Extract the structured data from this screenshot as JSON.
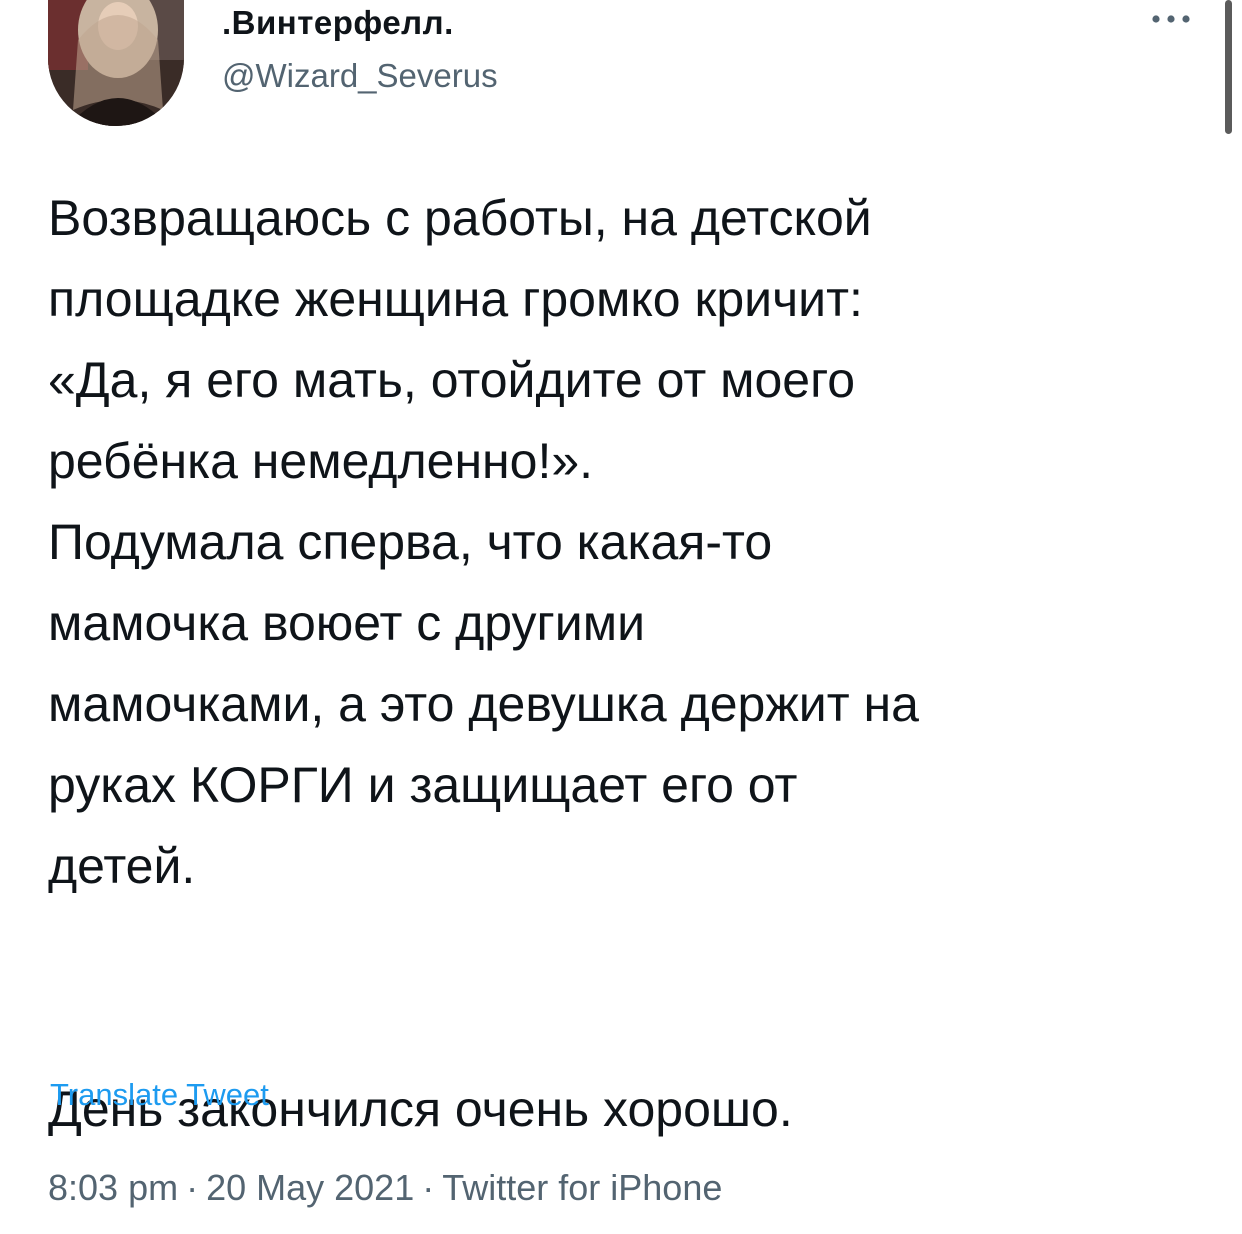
{
  "author": {
    "display_name": ".Винтерфелл.",
    "handle": "@Wizard_Severus",
    "avatar_icon": "avatar-icon"
  },
  "tweet": {
    "lines": [
      "Возвращаюсь с работы, на детской",
      "площадке женщина громко кричит:",
      "«Да, я его мать, отойдите от моего",
      "ребёнка немедленно!».",
      "Подумала сперва, что какая-то",
      "мамочка воюет с другими",
      "мамочками, а это девушка держит на",
      "руках КОРГИ и защищает его от",
      "детей."
    ],
    "closing_line": "День закончился очень хорошо.",
    "translate_label": "Translate Tweet"
  },
  "meta": {
    "time": "8:03 pm",
    "separator": "·",
    "date": "20 May 2021",
    "source": "Twitter for iPhone"
  },
  "icons": {
    "more": "more-horizontal-icon"
  },
  "colors": {
    "link": "#1d9bf0",
    "secondary_text": "#536471",
    "primary_text": "#0f1419"
  }
}
